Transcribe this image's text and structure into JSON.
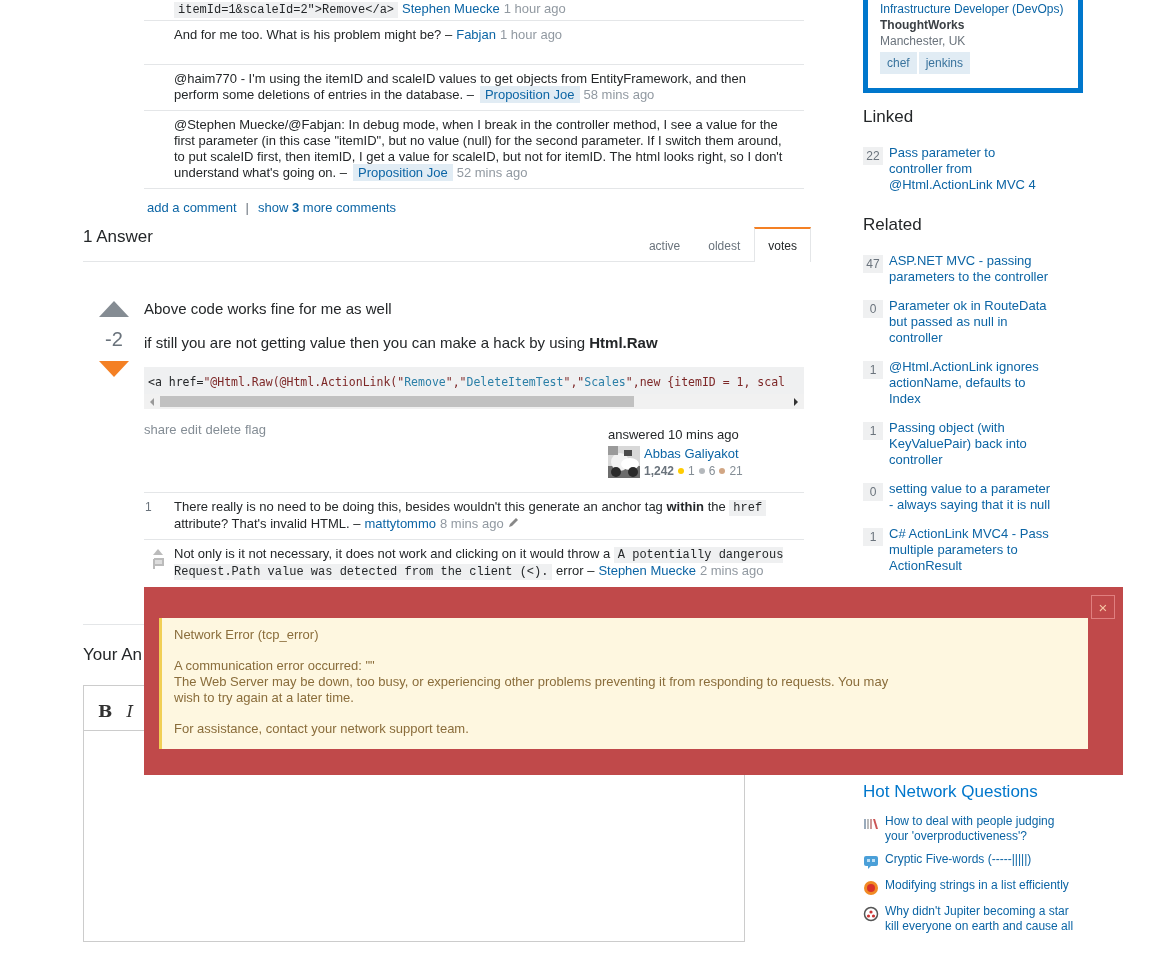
{
  "question_comments": [
    {
      "segments": [
        {
          "kind": "code",
          "text": "itemId=1&scaleId=2\">Remove</a>"
        }
      ],
      "author": "Stephen Muecke",
      "author_highlighted": false,
      "time": "1 hour ago"
    },
    {
      "segments": [
        {
          "kind": "text",
          "text": "And for me too. What is his problem might be? –"
        }
      ],
      "author": "Fabjan",
      "author_highlighted": false,
      "time": "1 hour ago"
    },
    {
      "segments": [
        {
          "kind": "text",
          "text": "@haim770 - I'm using the itemID and scaleID values to get objects from EntityFramework, and then perform some deletions of entries in the database. –"
        }
      ],
      "author": "Proposition Joe",
      "author_highlighted": true,
      "time": "58 mins ago"
    },
    {
      "segments": [
        {
          "kind": "text",
          "text": "@Stephen Muecke/@Fabjan: In debug mode, when I break in the controller method, I see a value for the first parameter (in this case \"itemID\", but no value (null) for the second parameter. If I switch them around, to put scaleID first, then itemID, I get a value for scaleID, but not for itemID. The html looks right, so I don't understand what's going on. –"
        }
      ],
      "author": "Proposition Joe",
      "author_highlighted": true,
      "time": "52 mins ago"
    }
  ],
  "comment_links": {
    "add": "add a comment",
    "separator": "|",
    "show_more": "show **3** more comments"
  },
  "answers_header": {
    "title": "1 Answer",
    "tabs": [
      {
        "label": "active",
        "selected": false
      },
      {
        "label": "oldest",
        "selected": false
      },
      {
        "label": "votes",
        "selected": true
      }
    ]
  },
  "answer": {
    "score": "-2",
    "upvoted": false,
    "downvoted": true,
    "paragraphs": [
      "Above code works fine for me as well",
      "if still you are not getting value then you can make a hack by using **Html.Raw**"
    ],
    "code": [
      {
        "kind": "plain",
        "text": "<a href="
      },
      {
        "kind": "attr",
        "text": "\"@Html.Raw(@Html.ActionLink(\""
      },
      {
        "kind": "str",
        "text": "Remove"
      },
      {
        "kind": "attr",
        "text": "\",\""
      },
      {
        "kind": "str",
        "text": "DeleteItemTest"
      },
      {
        "kind": "attr",
        "text": "\",\""
      },
      {
        "kind": "str",
        "text": "Scales"
      },
      {
        "kind": "attr",
        "text": "\",new {itemID = 1, scal"
      }
    ],
    "actions": [
      "share",
      "edit",
      "delete",
      "flag"
    ],
    "signature": {
      "label": "answered 10 mins ago",
      "user": "Abbas Galiyakot",
      "reputation": "1,242",
      "badges": [
        {
          "count": "1",
          "color": "#ffcc01"
        },
        {
          "count": "6",
          "color": "#b4b8bc"
        },
        {
          "count": "21",
          "color": "#d1a684"
        }
      ]
    },
    "comments": [
      {
        "score": "1",
        "voting": false,
        "segments": [
          {
            "kind": "text",
            "text": "There really is no need to be doing this, besides wouldn't this generate an anchor tag "
          },
          {
            "kind": "bold",
            "text": "within"
          },
          {
            "kind": "text",
            "text": " the "
          },
          {
            "kind": "code",
            "text": "href"
          },
          {
            "kind": "text",
            "text": " attribute? That's invalid HTML. –"
          }
        ],
        "author": "mattytommo",
        "author_highlighted": false,
        "time": "8 mins ago",
        "edited": true
      },
      {
        "voting": true,
        "segments": [
          {
            "kind": "text",
            "text": "Not only is it not necessary, it does not work and clicking on it would throw a "
          },
          {
            "kind": "code",
            "text": "A potentially dangerous Request.Path value was detected from the client (<)."
          },
          {
            "kind": "text",
            "text": " error –"
          }
        ],
        "author": "Stephen Muecke",
        "author_highlighted": false,
        "time": "2 mins ago",
        "edited": false
      }
    ]
  },
  "your_answer": {
    "heading": "Your An",
    "toolbar": [
      "B",
      "I"
    ]
  },
  "sidebar": {
    "profile": {
      "role": "Infrastructure Developer (DevOps)",
      "company": "ThoughtWorks",
      "location": "Manchester, UK",
      "tags": [
        "chef",
        "jenkins"
      ]
    },
    "linked": {
      "title": "Linked",
      "items": [
        {
          "count": "22",
          "title": "Pass parameter to controller from @Html.ActionLink MVC 4"
        }
      ]
    },
    "related": {
      "title": "Related",
      "items": [
        {
          "count": "47",
          "title": "ASP.NET MVC - passing parameters to the controller"
        },
        {
          "count": "0",
          "title": "Parameter ok in RouteData but passed as null in controller"
        },
        {
          "count": "1",
          "title": "@Html.ActionLink ignores actionName, defaults to Index"
        },
        {
          "count": "1",
          "title": "Passing object (with KeyValuePair) back into controller"
        },
        {
          "count": "0",
          "title": "setting value to a parameter - always saying that it is null"
        },
        {
          "count": "1",
          "title": "C# ActionLink MVC4 - Pass multiple parameters to ActionResult"
        }
      ]
    },
    "hot": {
      "title": "Hot Network Questions",
      "items": [
        {
          "title": "How to deal with people judging your 'overproductiveness'?"
        },
        {
          "title": "Cryptic Five-words (-----|||||)"
        },
        {
          "title": "Modifying strings in a list efficiently"
        },
        {
          "title": "Why didn't Jupiter becoming a star kill everyone on earth and cause all"
        }
      ]
    }
  },
  "error_dialog": {
    "close": "×",
    "title": "Network Error (tcp_error)",
    "paragraphs": [
      "A communication error occurred: \"\"\nThe Web Server may be down, too busy, or experiencing other problems preventing it from responding to requests. You may wish to try again at a later time.",
      "For assistance, contact your network support team."
    ]
  }
}
